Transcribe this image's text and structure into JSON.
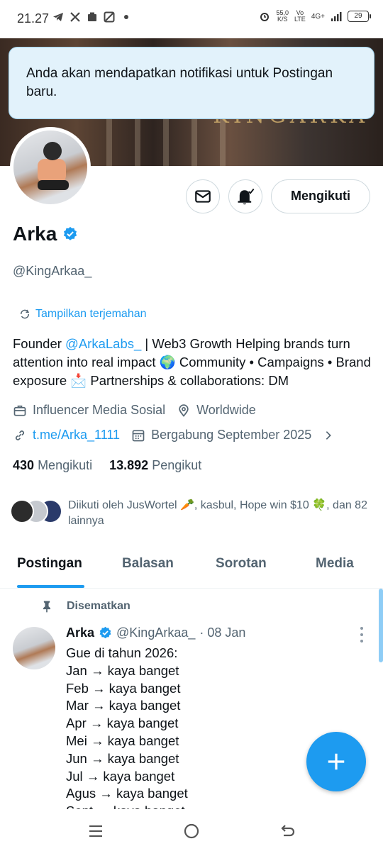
{
  "status_bar": {
    "time": "21.27",
    "speed_value": "55,0",
    "speed_unit": "K/S",
    "net1_top": "Vo",
    "net1_bottom": "LTE",
    "net2": "4G+",
    "battery": "29",
    "icons": [
      "telegram-icon",
      "x-icon",
      "app-icon",
      "image-icon",
      "dot-icon",
      "alarm-icon",
      "signal-icon",
      "battery-icon"
    ]
  },
  "banner": {
    "text": "KINGARKA"
  },
  "toast": {
    "message": "Anda akan mendapatkan notifikasi untuk Postingan baru."
  },
  "profile": {
    "name": "Arka",
    "handle": "@KingArkaa_",
    "verified": true,
    "translate_label": "Tampilkan terjemahan",
    "bio_prefix": "Founder ",
    "bio_mention": "@ArkaLabs_",
    "bio_rest": " | Web3 Growth Helping brands turn attention into real impact 🌍 Community • Campaigns • Brand exposure 📩 Partnerships & collaborations: DM",
    "category": "Influencer Media Sosial",
    "location": "Worldwide",
    "website": "t.me/Arka_1111",
    "joined": "Bergabung September 2025",
    "following_count": "430",
    "following_label": "Mengikuti",
    "followers_count": "13.892",
    "followers_label": "Pengikut",
    "followed_by": "Diikuti oleh JusWortel 🥕, kasbul, Hope win $10 🍀, dan 82 lainnya"
  },
  "actions": {
    "follow_label": "Mengikuti",
    "message_icon": "mail-icon",
    "notify_icon": "bell-check-icon"
  },
  "tabs": [
    {
      "label": "Postingan",
      "active": true
    },
    {
      "label": "Balasan",
      "active": false
    },
    {
      "label": "Sorotan",
      "active": false
    },
    {
      "label": "Media",
      "active": false
    }
  ],
  "post": {
    "pinned_label": "Disematkan",
    "author_name": "Arka",
    "author_handle": "@KingArkaa_",
    "date": "· 08 Jan",
    "lines": [
      "Gue di tahun 2026:",
      "Jan → kaya banget",
      "Feb → kaya banget",
      "Mar → kaya banget",
      "Apr → kaya banget",
      "Mei → kaya banget",
      "Jun → kaya banget",
      "Jul → kaya banget",
      "Agus → kaya banget",
      "Sept → kaya banget"
    ]
  },
  "colors": {
    "accent": "#1d9bf0",
    "text": "#0f1419",
    "muted": "#536471",
    "toast_bg": "#e2f2fb"
  }
}
